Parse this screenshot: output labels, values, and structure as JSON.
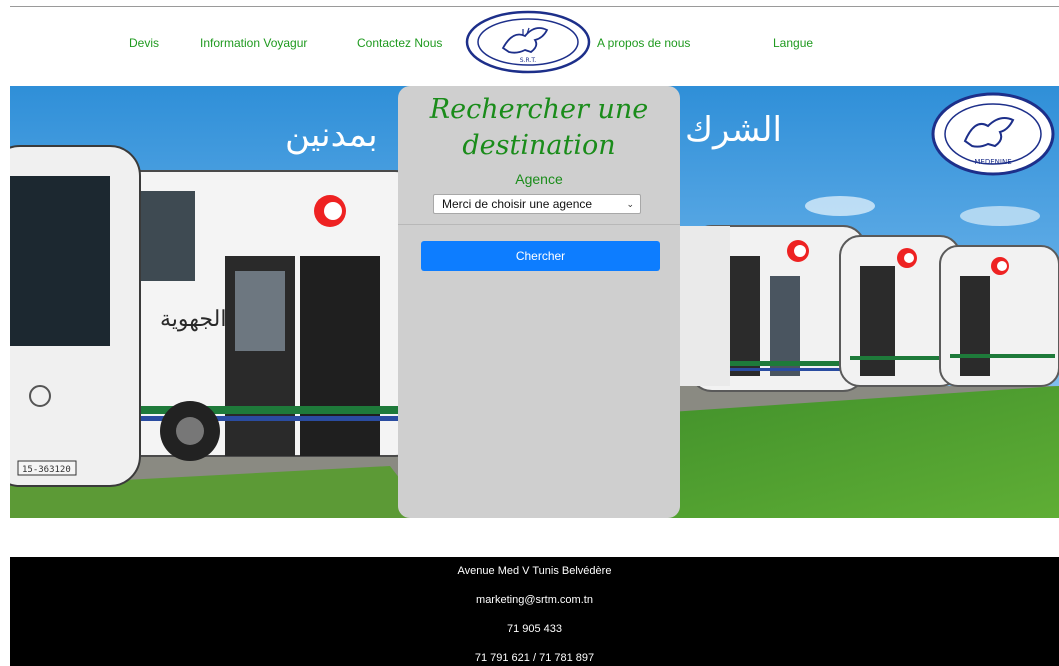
{
  "nav": {
    "devis": "Devis",
    "information": "Information Voyagur",
    "contact": "Contactez Nous",
    "apropos": "A propos de nous",
    "langue": "Langue"
  },
  "logo": {
    "alt": "S.R.T.M. logo",
    "text": "S.R.T.",
    "text_bottom": "MEDENINE"
  },
  "hero": {
    "arabic_left": "بمدنين",
    "arabic_right": "الشرك",
    "plate": "15-363120",
    "bus_text": "الجهوية"
  },
  "search": {
    "title": "Rechercher une destination",
    "agence_label": "Agence",
    "select_value": "Merci de choisir une agence",
    "button_label": "Chercher"
  },
  "footer": {
    "address": "Avenue Med V Tunis Belvédère",
    "email": "marketing@srtm.com.tn",
    "phone1": "71 905 433",
    "phone2": "71 791 621 / 71 781 897"
  },
  "colors": {
    "nav_text": "#1f9a1f",
    "title_green": "#1a8c1a",
    "button_blue": "#0d7dff",
    "panel_grey": "#cfcfcf",
    "footer_bg": "#000000"
  }
}
